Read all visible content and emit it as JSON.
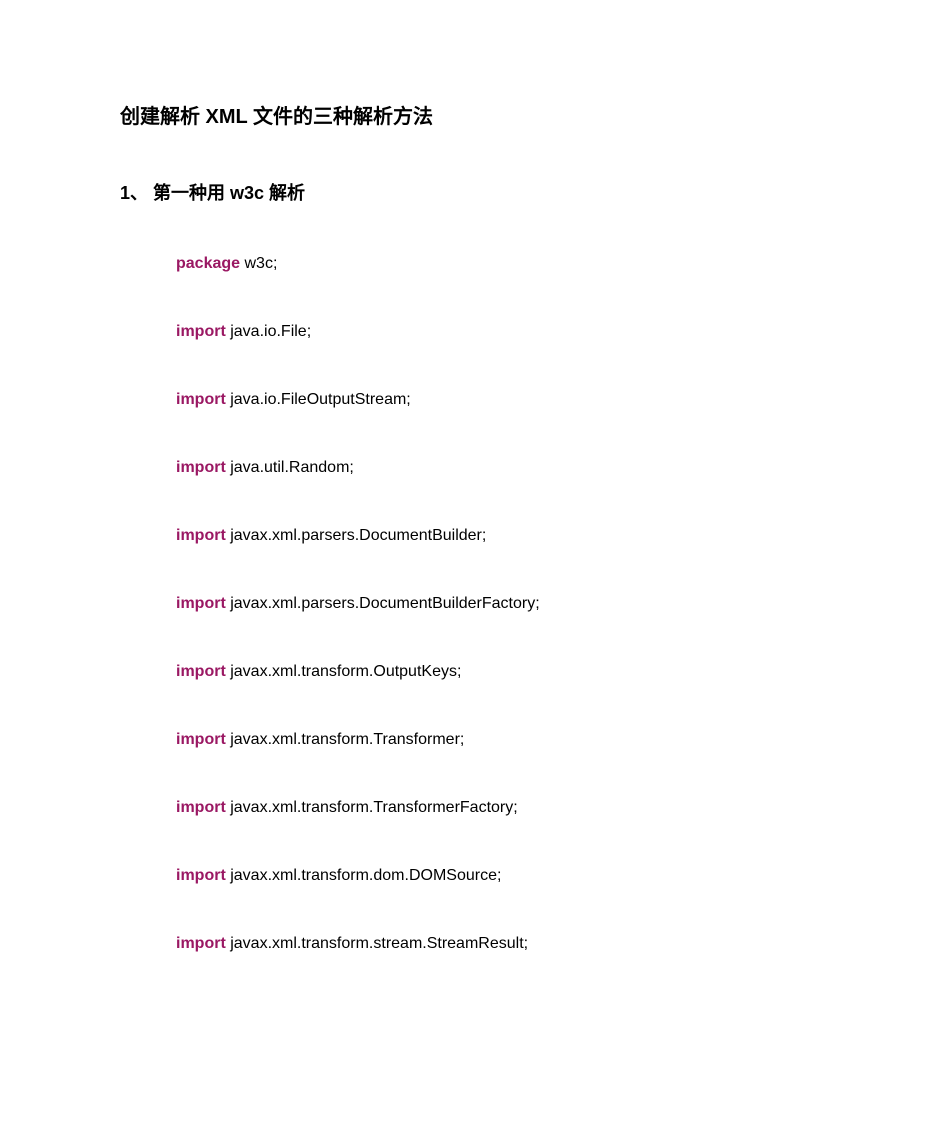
{
  "title": "创建解析 XML 文件的三种解析方法",
  "subtitle": "1、    第一种用 w3c 解析",
  "code_lines": [
    {
      "keyword": "package",
      "rest": "  w3c;"
    },
    {
      "keyword": "import",
      "rest": "  java.io.File;"
    },
    {
      "keyword": "import",
      "rest": "  java.io.FileOutputStream;"
    },
    {
      "keyword": "import",
      "rest": "  java.util.Random;"
    },
    {
      "keyword": "import",
      "rest": "  javax.xml.parsers.DocumentBuilder;"
    },
    {
      "keyword": "import",
      "rest": "  javax.xml.parsers.DocumentBuilderFactory;"
    },
    {
      "keyword": "import",
      "rest": "  javax.xml.transform.OutputKeys;"
    },
    {
      "keyword": "import",
      "rest": "  javax.xml.transform.Transformer;"
    },
    {
      "keyword": "import",
      "rest": "  javax.xml.transform.TransformerFactory;"
    },
    {
      "keyword": "import",
      "rest": "  javax.xml.transform.dom.DOMSource;"
    },
    {
      "keyword": "import",
      "rest": "  javax.xml.transform.stream.StreamResult;"
    }
  ]
}
